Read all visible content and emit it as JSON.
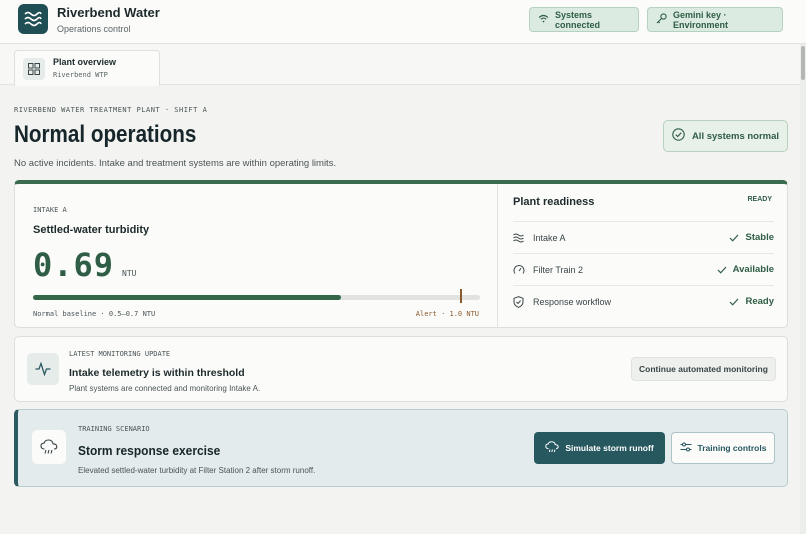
{
  "app": {
    "name": "Riverbend Water",
    "subtitle": "Operations control"
  },
  "header_actions": {
    "connected_label": "Systems connected",
    "gemini_label": "Gemini key · Environment"
  },
  "tabs": [
    {
      "label": "Plant overview",
      "sublabel": "Riverbend WTP",
      "icon": "grid-icon"
    }
  ],
  "page": {
    "eyebrow": "RIVERBEND WATER TREATMENT PLANT · SHIFT A",
    "title": "Normal operations",
    "description": "No active incidents. Intake and treatment systems are within operating limits.",
    "status_badge": "All systems normal"
  },
  "metric": {
    "source": "INTAKE A",
    "title": "Settled-water turbidity",
    "value": "0.69",
    "unit": "NTU",
    "fill_fraction": 0.69,
    "baseline_label": "Normal baseline · 0.5–0.7 NTU",
    "alert_label": "Alert · 1.0 NTU"
  },
  "readiness": {
    "title": "Plant readiness",
    "status": "READY",
    "rows": [
      {
        "label": "Intake A",
        "value": "Stable",
        "icon": "waves-icon"
      },
      {
        "label": "Filter Train 2",
        "value": "Available",
        "icon": "gauge-icon"
      },
      {
        "label": "Response workflow",
        "value": "Ready",
        "icon": "shield-check-icon"
      }
    ]
  },
  "update": {
    "eyebrow": "LATEST MONITORING UPDATE",
    "title": "Intake telemetry is within threshold",
    "description": "Plant systems are connected and monitoring Intake A.",
    "action_label": "Continue automated monitoring"
  },
  "training": {
    "eyebrow": "TRAINING SCENARIO",
    "title": "Storm response exercise",
    "description": "Elevated settled-water turbidity at Filter Station 2 after storm runoff.",
    "primary_label": "Simulate storm runoff",
    "secondary_label": "Training controls"
  },
  "colors": {
    "brand": "#1f4f55",
    "success": "#2f5d45",
    "alert": "#8a5a2c",
    "primary_button": "#275860"
  }
}
